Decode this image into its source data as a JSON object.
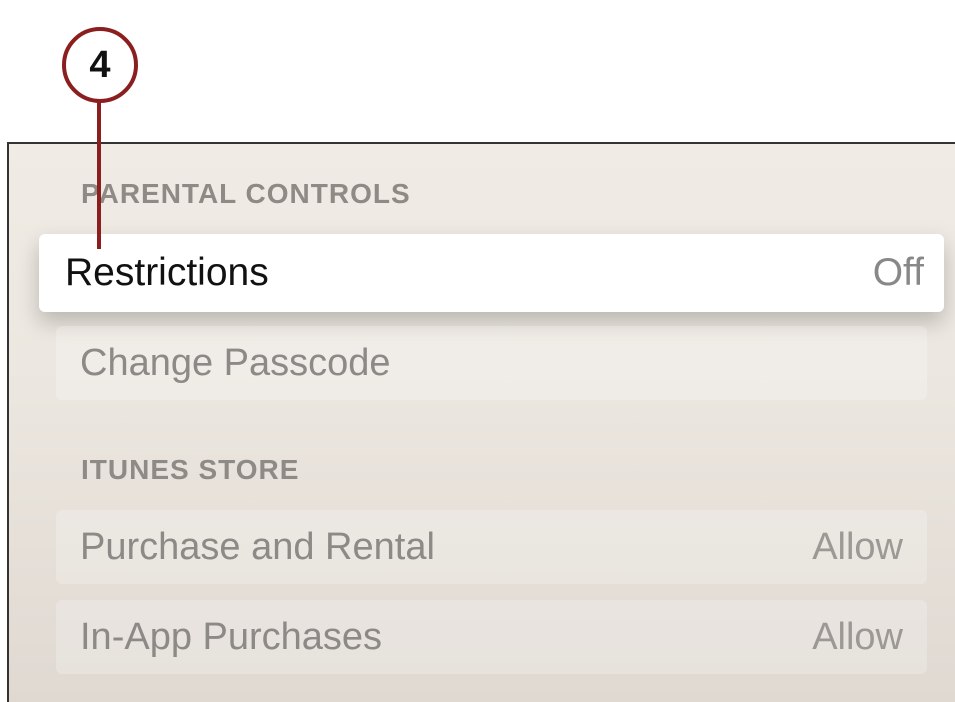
{
  "callout": {
    "number": "4",
    "color": "#8b1e1e"
  },
  "parental_controls": {
    "header": "PARENTAL CONTROLS",
    "items": [
      {
        "label": "Restrictions",
        "value": "Off",
        "focused": true
      },
      {
        "label": "Change Passcode",
        "value": "",
        "focused": false
      }
    ]
  },
  "itunes_store": {
    "header": "ITUNES STORE",
    "items": [
      {
        "label": "Purchase and Rental",
        "value": "Allow"
      },
      {
        "label": "In-App Purchases",
        "value": "Allow"
      }
    ]
  }
}
